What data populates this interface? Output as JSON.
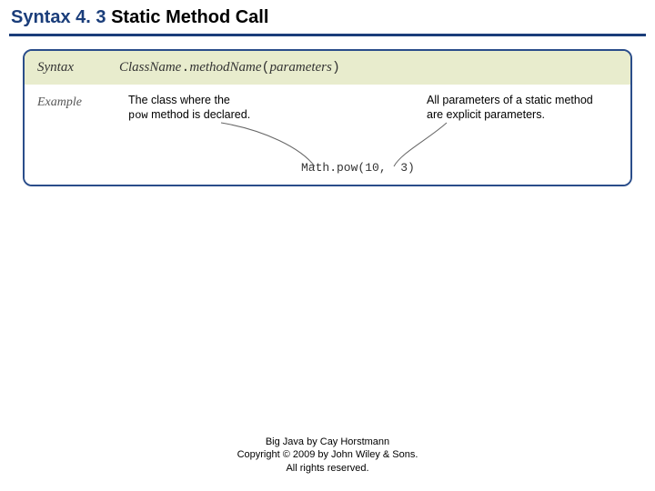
{
  "title": {
    "prefix": "Syntax 4. 3",
    "main": " Static Method Call"
  },
  "syntax": {
    "label": "Syntax",
    "classname": "ClassName",
    "method": "methodName",
    "params": "parameters"
  },
  "example": {
    "label": "Example",
    "note_left_line1": "The class where the",
    "note_left_pow": "pow",
    "note_left_line2": " method is declared.",
    "note_right_line1": "All parameters of a static method",
    "note_right_line2": "are explicit parameters.",
    "call": "Math.pow(10,  3)"
  },
  "footer": {
    "line1": "Big Java by Cay Horstmann",
    "line2": "Copyright © 2009 by John Wiley & Sons.",
    "line3": "All rights reserved."
  }
}
